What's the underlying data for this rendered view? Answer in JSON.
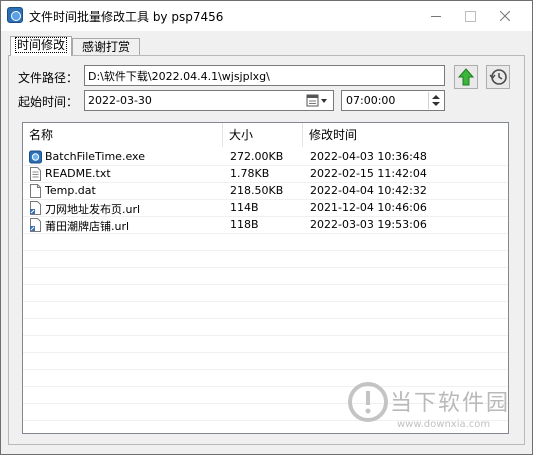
{
  "window": {
    "title": "文件时间批量修改工具 by psp7456",
    "icon": "app-clock-icon"
  },
  "tabs": [
    {
      "label": "时间修改",
      "active": true
    },
    {
      "label": "感谢打赏",
      "active": false
    }
  ],
  "form": {
    "path_label": "文件路径：",
    "path_value": "D:\\软件下载\\2022.04.4.1\\wjsjplxg\\",
    "start_label": "起始时间：",
    "date_value": "2022-03-30",
    "time_value": "07:00:00"
  },
  "buttons": {
    "up_icon": "green-up-arrow-icon",
    "history_icon": "history-clock-icon"
  },
  "table": {
    "columns": [
      "名称",
      "大小",
      "修改时间"
    ],
    "rows": [
      {
        "name": "BatchFileTime.exe",
        "size": "272.00KB",
        "time": "2022-04-03 10:36:48",
        "icon": "exe-icon"
      },
      {
        "name": "README.txt",
        "size": "1.78KB",
        "time": "2022-02-15 11:42:04",
        "icon": "text-file-icon"
      },
      {
        "name": "Temp.dat",
        "size": "218.50KB",
        "time": "2022-04-04 10:42:32",
        "icon": "blank-file-icon"
      },
      {
        "name": "刀网地址发布页.url",
        "size": "114B",
        "time": "2021-12-04 10:46:06",
        "icon": "url-file-icon"
      },
      {
        "name": "莆田潮牌店铺.url",
        "size": "118B",
        "time": "2022-03-03 19:53:06",
        "icon": "url-file-icon"
      }
    ]
  },
  "watermark": {
    "text": "当下软件园",
    "url": "www.downxia.com"
  }
}
